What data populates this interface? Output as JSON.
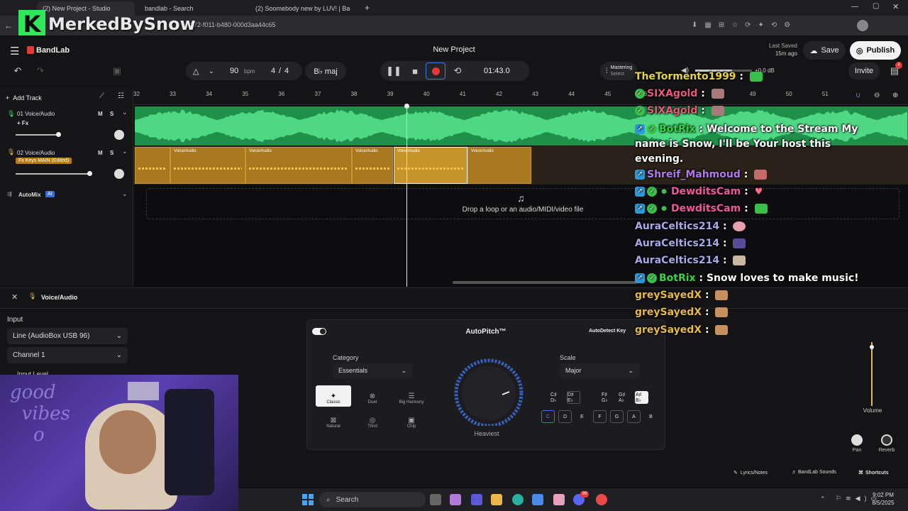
{
  "browser": {
    "tabs": [
      {
        "label": "(2) New Project - Studio",
        "active": true
      },
      {
        "label": "bandlab - Search",
        "active": false
      },
      {
        "label": "(2) Soomebody new by LUV! | Ba",
        "active": false
      }
    ],
    "url": "-9172-f011-b480-000d3aa44c65"
  },
  "watermark": {
    "letter": "K",
    "text": "MerkedBySnow"
  },
  "app": {
    "brand": "BandLab",
    "project_title": "New Project",
    "last_saved_label": "Last Saved",
    "last_saved_time": "15m ago",
    "save_label": "Save",
    "publish_label": "Publish",
    "invite_label": "Invite",
    "notif_count": "4",
    "tempo": "90",
    "tempo_unit": "bpm",
    "time_sig_num": "4",
    "time_sig_slash": "/",
    "time_sig_den": "4",
    "key": "B♭ maj",
    "time_display": "01:43.0",
    "mastering_label": "Mastering",
    "mastering_select": "Select",
    "volume_db": "+0.0 dB"
  },
  "tracks": {
    "add_track_label": "Add Track",
    "ruler": [
      "32",
      "33",
      "34",
      "35",
      "36",
      "37",
      "38",
      "39",
      "40",
      "41",
      "42",
      "43",
      "44",
      "45",
      "46",
      "47",
      "48",
      "49",
      "50",
      "51"
    ],
    "items": [
      {
        "name": "01  Voice/Audio",
        "fx": "+ Fx",
        "m": "M",
        "s": "S"
      },
      {
        "name": "02  Voice/Audio",
        "fx": "Fx  Keys MAIN (Edited)",
        "m": "M",
        "s": "S"
      }
    ],
    "automix_label": "AutoMix",
    "automix_badge": "AI",
    "clips": [
      {
        "name": "Voice/Audio"
      },
      {
        "name": "Voice/Audio"
      },
      {
        "name": "Voice/Audio"
      },
      {
        "name": "Voice/Audio"
      },
      {
        "name": "Voice/Audio"
      },
      {
        "name": "Voice/Audio"
      }
    ],
    "drop_text": "Drop a loop or an audio/MIDI/video file"
  },
  "panel": {
    "track_title": "Voice/Audio",
    "input_label": "Input",
    "input_device": "Line (AudioBox USB 96)",
    "channel": "Channel 1",
    "input_level_label": "Input Level",
    "autopitch_title": "AutoPitch™",
    "autodetect_label": "AutoDetect Key",
    "category_label": "Category",
    "category_value": "Essentials",
    "scale_label": "Scale",
    "scale_value": "Major",
    "knob_label": "Heaviest",
    "presets": [
      "Classic",
      "Duet",
      "Big Harmony",
      "Natural",
      "Third",
      "Chip"
    ],
    "keys_top": [
      {
        "label": "C♯ D♭",
        "state": "off"
      },
      {
        "label": "D♯ E♭",
        "state": "bordered"
      },
      {
        "label": "F♯ G♭",
        "state": "off"
      },
      {
        "label": "G♯ A♭",
        "state": "off"
      },
      {
        "label": "A♯ B♭",
        "state": "on"
      }
    ],
    "keys_bottom": [
      {
        "label": "C",
        "state": "selected"
      },
      {
        "label": "D",
        "state": "bordered"
      },
      {
        "label": "E",
        "state": "off"
      },
      {
        "label": "F",
        "state": "bordered"
      },
      {
        "label": "G",
        "state": "bordered"
      },
      {
        "label": "A",
        "state": "bordered"
      },
      {
        "label": "B",
        "state": "off"
      }
    ],
    "volume_label": "Volume",
    "pan_label": "Pan",
    "reverb_label": "Reverb",
    "lyrics_label": "Lyrics/Notes",
    "sounds_label": "BandLab Sounds",
    "shortcuts_label": "Shortcuts"
  },
  "chat": [
    {
      "user": "TheTormento1999",
      "text": "",
      "color": "#e6d34a"
    },
    {
      "user": "SIXAgold",
      "text": "",
      "color": "#e85a7a"
    },
    {
      "user": "SIXAgold",
      "text": "",
      "color": "#e85a7a"
    },
    {
      "user": "BotRix",
      "text": "Welcome to the Stream My name is Snow, I'll be Your host this evening.",
      "color": "#38d146"
    },
    {
      "user": "Shreif_Mahmoud",
      "text": "",
      "color": "#b07ae8"
    },
    {
      "user": "DewditsCam",
      "text": "",
      "color": "#e85a9a"
    },
    {
      "user": "DewditsCam",
      "text": "",
      "color": "#e85a9a"
    },
    {
      "user": "AuraCeltics214",
      "text": "",
      "color": "#a9a9e8"
    },
    {
      "user": "AuraCeltics214",
      "text": "",
      "color": "#a9a9e8"
    },
    {
      "user": "AuraCeltics214",
      "text": "",
      "color": "#a9a9e8"
    },
    {
      "user": "BotRix",
      "text": "Snow loves to make music!",
      "color": "#38d146"
    },
    {
      "user": "greySayedX",
      "text": "",
      "color": "#e6b94a"
    },
    {
      "user": "greySayedX",
      "text": "",
      "color": "#e6b94a"
    },
    {
      "user": "greySayedX",
      "text": "",
      "color": "#e6b94a"
    }
  ],
  "taskbar": {
    "search_label": "Search",
    "time": "9:02 PM",
    "date": "8/5/2025",
    "notif": "99"
  },
  "colors": {
    "accent_green": "#2ee859",
    "record_red": "#e53935",
    "clip_gold": "#a8791e",
    "lane_green": "#1f8f4a"
  }
}
